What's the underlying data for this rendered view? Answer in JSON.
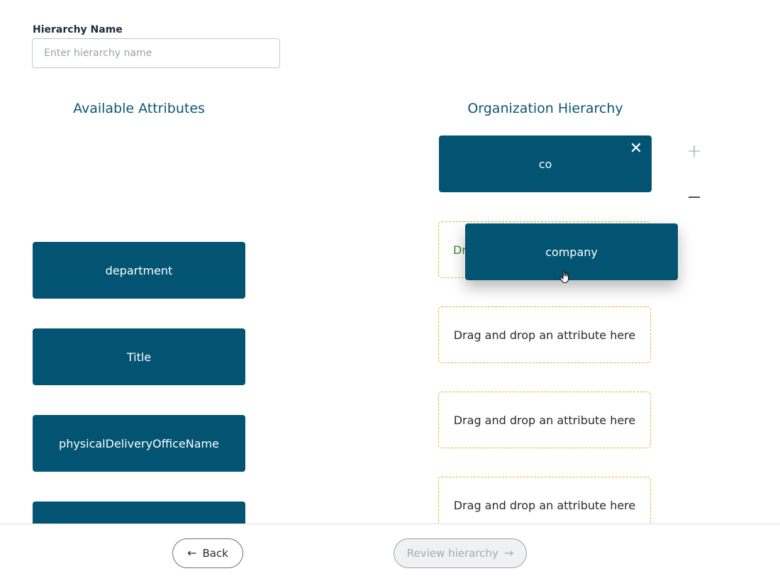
{
  "form": {
    "name_label": "Hierarchy Name",
    "name_placeholder": "Enter hierarchy name",
    "name_value": ""
  },
  "available": {
    "heading": "Available Attributes",
    "items": [
      {
        "label": "department"
      },
      {
        "label": "Title"
      },
      {
        "label": "physicalDeliveryOfficeName"
      },
      {
        "label": ""
      }
    ]
  },
  "hierarchy": {
    "heading": "Organization Hierarchy",
    "levels": [
      {
        "label": "co"
      }
    ],
    "dropzones": [
      {
        "label": "Dr"
      },
      {
        "label": "Drag and drop an attribute here"
      },
      {
        "label": "Drag and drop an attribute here"
      },
      {
        "label": "Drag and drop an attribute here"
      }
    ],
    "add_icon": "plus-icon",
    "remove_icon": "minus-icon"
  },
  "drag": {
    "label": "company"
  },
  "footer": {
    "back_label": "Back",
    "back_icon": "arrow-left-icon",
    "review_label": "Review hierarchy",
    "review_icon": "arrow-right-icon"
  },
  "colors": {
    "tile": "#025472",
    "heading": "#0e5574",
    "dropzone_border": "#e8b020"
  }
}
